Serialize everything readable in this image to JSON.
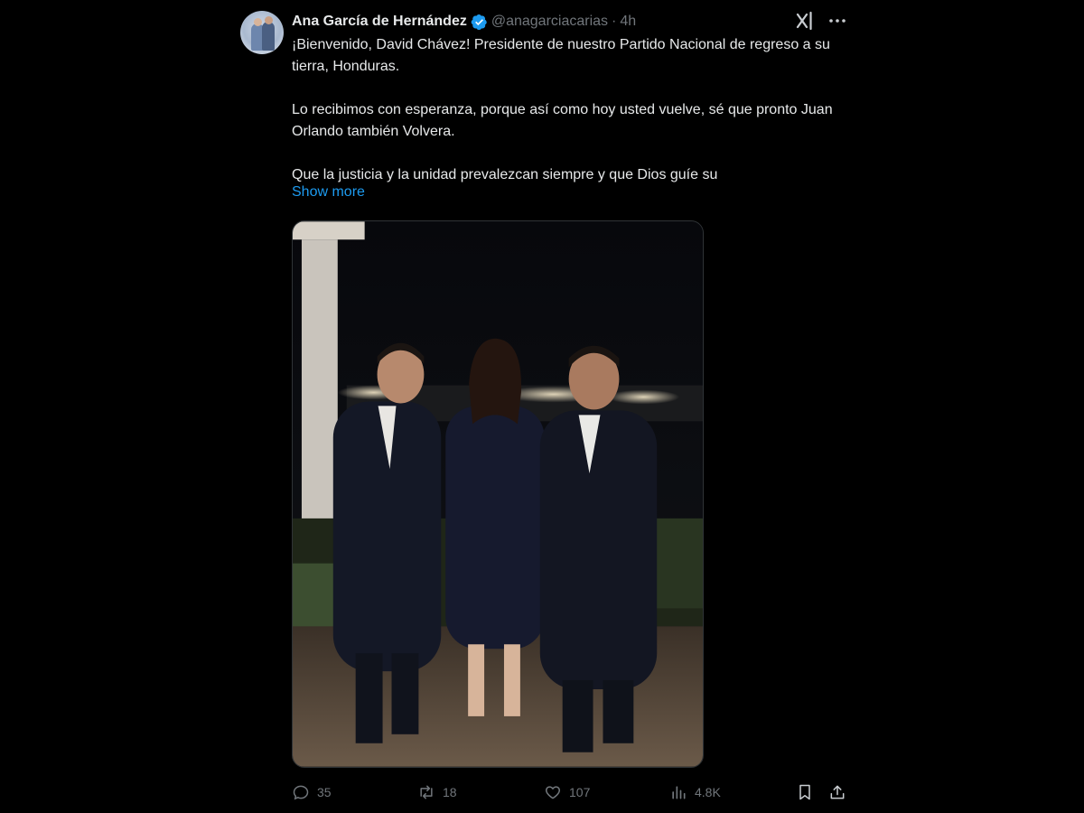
{
  "author": {
    "display_name": "Ana García de Hernández",
    "handle": "@anagarciacarias",
    "separator": "·",
    "time": "4h",
    "verified": true
  },
  "tweet": {
    "paragraphs": [
      "¡Bienvenido, David Chávez! Presidente de nuestro Partido Nacional de regreso a su tierra, Honduras.",
      "Lo recibimos con esperanza, porque así como hoy usted vuelve, sé que pronto Juan Orlando también Volvera.",
      "Que la justicia y la unidad prevalezcan siempre  y que Dios guíe su"
    ],
    "show_more": "Show more"
  },
  "actions": {
    "replies": "35",
    "reposts": "18",
    "likes": "107",
    "views": "4.8K"
  },
  "icons": {
    "verified": "verified-badge-icon",
    "grok": "grok-icon",
    "more": "more-icon",
    "reply": "reply-icon",
    "repost": "repost-icon",
    "like": "heart-icon",
    "views": "views-icon",
    "bookmark": "bookmark-icon",
    "share": "share-icon"
  },
  "colors": {
    "background": "#000000",
    "text": "#e7e9ea",
    "muted": "#71767b",
    "accent": "#1d9bf0"
  }
}
